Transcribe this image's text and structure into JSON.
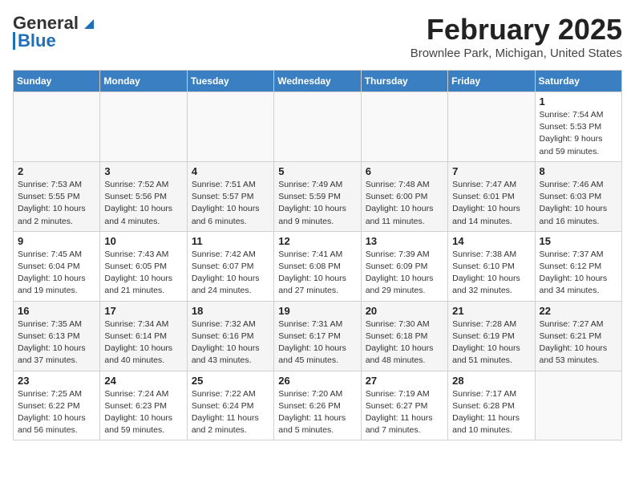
{
  "header": {
    "logo_general": "General",
    "logo_blue": "Blue",
    "month_title": "February 2025",
    "location": "Brownlee Park, Michigan, United States"
  },
  "weekdays": [
    "Sunday",
    "Monday",
    "Tuesday",
    "Wednesday",
    "Thursday",
    "Friday",
    "Saturday"
  ],
  "weeks": [
    [
      {
        "day": "",
        "info": ""
      },
      {
        "day": "",
        "info": ""
      },
      {
        "day": "",
        "info": ""
      },
      {
        "day": "",
        "info": ""
      },
      {
        "day": "",
        "info": ""
      },
      {
        "day": "",
        "info": ""
      },
      {
        "day": "1",
        "info": "Sunrise: 7:54 AM\nSunset: 5:53 PM\nDaylight: 9 hours and 59 minutes."
      }
    ],
    [
      {
        "day": "2",
        "info": "Sunrise: 7:53 AM\nSunset: 5:55 PM\nDaylight: 10 hours and 2 minutes."
      },
      {
        "day": "3",
        "info": "Sunrise: 7:52 AM\nSunset: 5:56 PM\nDaylight: 10 hours and 4 minutes."
      },
      {
        "day": "4",
        "info": "Sunrise: 7:51 AM\nSunset: 5:57 PM\nDaylight: 10 hours and 6 minutes."
      },
      {
        "day": "5",
        "info": "Sunrise: 7:49 AM\nSunset: 5:59 PM\nDaylight: 10 hours and 9 minutes."
      },
      {
        "day": "6",
        "info": "Sunrise: 7:48 AM\nSunset: 6:00 PM\nDaylight: 10 hours and 11 minutes."
      },
      {
        "day": "7",
        "info": "Sunrise: 7:47 AM\nSunset: 6:01 PM\nDaylight: 10 hours and 14 minutes."
      },
      {
        "day": "8",
        "info": "Sunrise: 7:46 AM\nSunset: 6:03 PM\nDaylight: 10 hours and 16 minutes."
      }
    ],
    [
      {
        "day": "9",
        "info": "Sunrise: 7:45 AM\nSunset: 6:04 PM\nDaylight: 10 hours and 19 minutes."
      },
      {
        "day": "10",
        "info": "Sunrise: 7:43 AM\nSunset: 6:05 PM\nDaylight: 10 hours and 21 minutes."
      },
      {
        "day": "11",
        "info": "Sunrise: 7:42 AM\nSunset: 6:07 PM\nDaylight: 10 hours and 24 minutes."
      },
      {
        "day": "12",
        "info": "Sunrise: 7:41 AM\nSunset: 6:08 PM\nDaylight: 10 hours and 27 minutes."
      },
      {
        "day": "13",
        "info": "Sunrise: 7:39 AM\nSunset: 6:09 PM\nDaylight: 10 hours and 29 minutes."
      },
      {
        "day": "14",
        "info": "Sunrise: 7:38 AM\nSunset: 6:10 PM\nDaylight: 10 hours and 32 minutes."
      },
      {
        "day": "15",
        "info": "Sunrise: 7:37 AM\nSunset: 6:12 PM\nDaylight: 10 hours and 34 minutes."
      }
    ],
    [
      {
        "day": "16",
        "info": "Sunrise: 7:35 AM\nSunset: 6:13 PM\nDaylight: 10 hours and 37 minutes."
      },
      {
        "day": "17",
        "info": "Sunrise: 7:34 AM\nSunset: 6:14 PM\nDaylight: 10 hours and 40 minutes."
      },
      {
        "day": "18",
        "info": "Sunrise: 7:32 AM\nSunset: 6:16 PM\nDaylight: 10 hours and 43 minutes."
      },
      {
        "day": "19",
        "info": "Sunrise: 7:31 AM\nSunset: 6:17 PM\nDaylight: 10 hours and 45 minutes."
      },
      {
        "day": "20",
        "info": "Sunrise: 7:30 AM\nSunset: 6:18 PM\nDaylight: 10 hours and 48 minutes."
      },
      {
        "day": "21",
        "info": "Sunrise: 7:28 AM\nSunset: 6:19 PM\nDaylight: 10 hours and 51 minutes."
      },
      {
        "day": "22",
        "info": "Sunrise: 7:27 AM\nSunset: 6:21 PM\nDaylight: 10 hours and 53 minutes."
      }
    ],
    [
      {
        "day": "23",
        "info": "Sunrise: 7:25 AM\nSunset: 6:22 PM\nDaylight: 10 hours and 56 minutes."
      },
      {
        "day": "24",
        "info": "Sunrise: 7:24 AM\nSunset: 6:23 PM\nDaylight: 10 hours and 59 minutes."
      },
      {
        "day": "25",
        "info": "Sunrise: 7:22 AM\nSunset: 6:24 PM\nDaylight: 11 hours and 2 minutes."
      },
      {
        "day": "26",
        "info": "Sunrise: 7:20 AM\nSunset: 6:26 PM\nDaylight: 11 hours and 5 minutes."
      },
      {
        "day": "27",
        "info": "Sunrise: 7:19 AM\nSunset: 6:27 PM\nDaylight: 11 hours and 7 minutes."
      },
      {
        "day": "28",
        "info": "Sunrise: 7:17 AM\nSunset: 6:28 PM\nDaylight: 11 hours and 10 minutes."
      },
      {
        "day": "",
        "info": ""
      }
    ]
  ]
}
